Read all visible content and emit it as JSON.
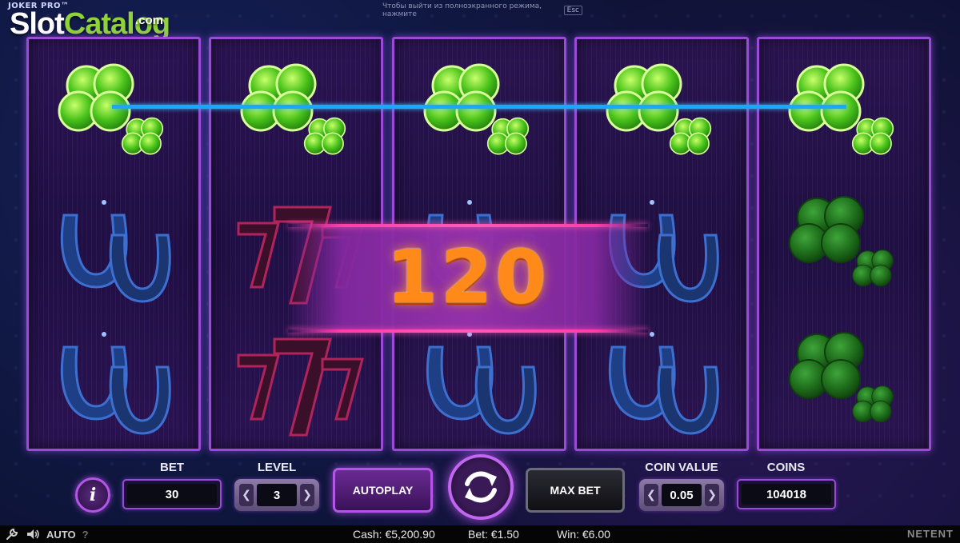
{
  "branding": {
    "game_title": "JOKER PRO™",
    "watermark_part1": "Slot",
    "watermark_part2": "Catalog",
    "watermark_suffix": ".com"
  },
  "fullscreen_notice": {
    "text": "Чтобы выйти из полноэкранного режима, нажмите",
    "key": "Esc"
  },
  "reels": [
    [
      "four-leaf-clover",
      "horseshoe",
      "horseshoe"
    ],
    [
      "four-leaf-clover",
      "seven",
      "seven"
    ],
    [
      "four-leaf-clover",
      "horseshoe",
      "horseshoe"
    ],
    [
      "four-leaf-clover",
      "horseshoe",
      "horseshoe"
    ],
    [
      "four-leaf-clover",
      "four-leaf-clover",
      "four-leaf-clover"
    ]
  ],
  "win": {
    "amount": "120"
  },
  "controls": {
    "bet_label": "BET",
    "bet_value": "30",
    "level_label": "LEVEL",
    "level_value": "3",
    "autoplay_label": "AUTOPLAY",
    "max_bet_label": "MAX BET",
    "coin_value_label": "COIN VALUE",
    "coin_value": "0.05",
    "coins_label": "COINS",
    "coins_value": "104018",
    "info_label": "i",
    "left_arrow": "❮",
    "right_arrow": "❯"
  },
  "status_bar": {
    "auto_label": "AUTO",
    "help_label": "?",
    "cash": "Cash: €5,200.90",
    "bet": "Bet: €1.50",
    "win": "Win: €6.00",
    "provider": "NETENT"
  },
  "colors": {
    "payline": "#1aa7ff",
    "reel_border": "#9a4bd6",
    "win_text": "#ff8a1a",
    "clover_bright": "#5ed62a",
    "clover_dim": "#1f7a1c",
    "horseshoe": "#1e3f86"
  }
}
